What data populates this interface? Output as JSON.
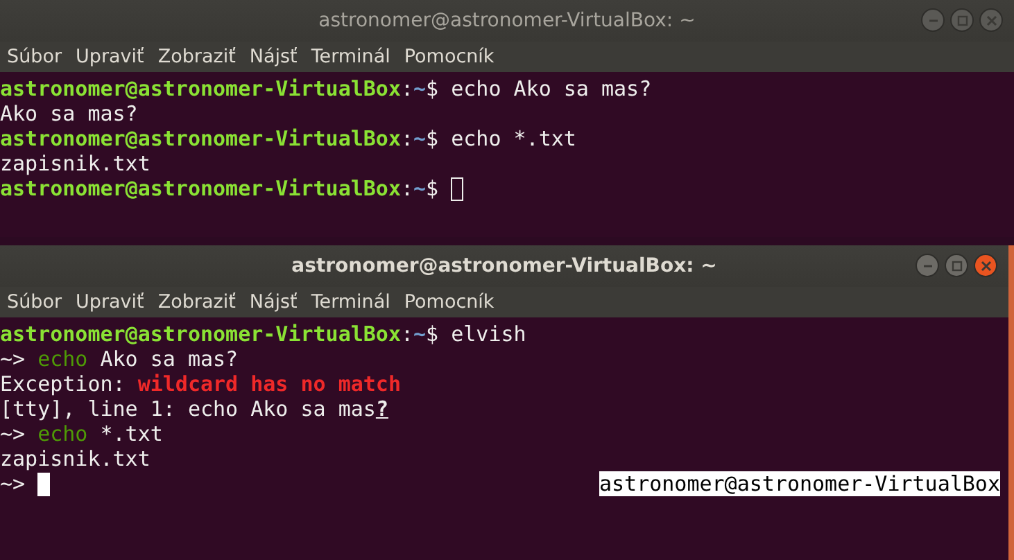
{
  "windows": [
    {
      "title": "astronomer@astronomer-VirtualBox: ~",
      "active": false,
      "menu": [
        "Súbor",
        "Upraviť",
        "Zobraziť",
        "Nájsť",
        "Terminál",
        "Pomocník"
      ],
      "lines": [
        {
          "segments": [
            {
              "text": "astronomer@astronomer-VirtualBox",
              "kind": "host"
            },
            {
              "text": ":",
              "kind": "plain"
            },
            {
              "text": "~",
              "kind": "path"
            },
            {
              "text": "$ echo Ako sa mas?",
              "kind": "plain"
            }
          ]
        },
        {
          "segments": [
            {
              "text": "Ako sa mas?",
              "kind": "plain"
            }
          ]
        },
        {
          "segments": [
            {
              "text": "astronomer@astronomer-VirtualBox",
              "kind": "host"
            },
            {
              "text": ":",
              "kind": "plain"
            },
            {
              "text": "~",
              "kind": "path"
            },
            {
              "text": "$ echo *.txt",
              "kind": "plain"
            }
          ]
        },
        {
          "segments": [
            {
              "text": "zapisnik.txt",
              "kind": "plain"
            }
          ]
        },
        {
          "segments": [
            {
              "text": "astronomer@astronomer-VirtualBox",
              "kind": "host"
            },
            {
              "text": ":",
              "kind": "plain"
            },
            {
              "text": "~",
              "kind": "path"
            },
            {
              "text": "$ ",
              "kind": "plain"
            }
          ],
          "cursor": true
        }
      ]
    },
    {
      "title": "astronomer@astronomer-VirtualBox: ~",
      "active": true,
      "menu": [
        "Súbor",
        "Upraviť",
        "Zobraziť",
        "Nájsť",
        "Terminál",
        "Pomocník"
      ],
      "lines": [
        {
          "segments": [
            {
              "text": "astronomer@astronomer-VirtualBox",
              "kind": "host"
            },
            {
              "text": ":",
              "kind": "plain"
            },
            {
              "text": "~",
              "kind": "path"
            },
            {
              "text": "$ elvish",
              "kind": "plain"
            }
          ]
        },
        {
          "segments": [
            {
              "text": "~> ",
              "kind": "plain"
            },
            {
              "text": "echo",
              "kind": "command"
            },
            {
              "text": " Ako sa mas?",
              "kind": "plain"
            }
          ]
        },
        {
          "segments": [
            {
              "text": "Exception: ",
              "kind": "plain"
            },
            {
              "text": "wildcard has no match",
              "kind": "error"
            }
          ]
        },
        {
          "segments": [
            {
              "text": "[tty], line 1: echo Ako sa mas",
              "kind": "plain"
            },
            {
              "text": "?",
              "kind": "marker"
            }
          ]
        },
        {
          "segments": [
            {
              "text": "~> ",
              "kind": "plain"
            },
            {
              "text": "echo",
              "kind": "command"
            },
            {
              "text": " *.txt",
              "kind": "plain"
            }
          ]
        },
        {
          "segments": [
            {
              "text": "zapisnik.txt",
              "kind": "plain"
            }
          ]
        },
        {
          "segments": [
            {
              "text": "~> ",
              "kind": "plain"
            }
          ],
          "cursor": true,
          "right_prompt": "astronomer@astronomer-VirtualBox"
        }
      ]
    }
  ]
}
